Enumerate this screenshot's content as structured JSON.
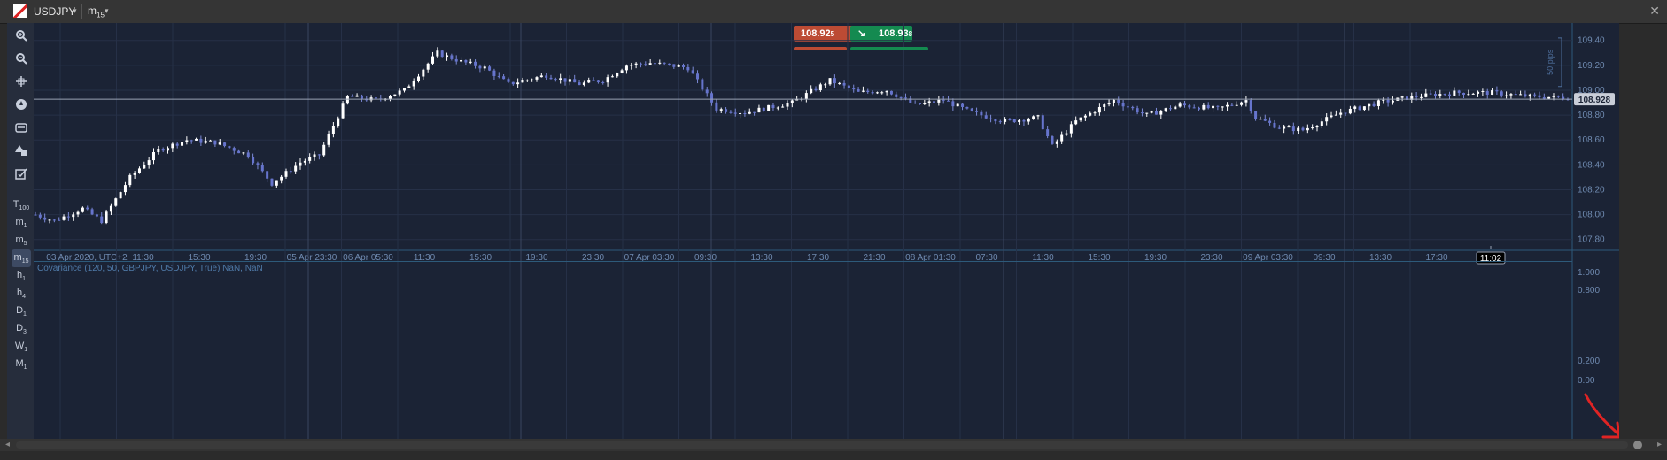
{
  "window": {
    "symbol": "USDJPY",
    "timeframe": "m",
    "timeframe_sub": "15"
  },
  "toolbar": {
    "tools": [
      "zoom-in-icon",
      "zoom-out-icon",
      "crosshair-icon",
      "compass-icon",
      "camera-icon",
      "shapes-icon",
      "checklist-icon"
    ],
    "timeframes": [
      {
        "label": "T",
        "sub": "100"
      },
      {
        "label": "m",
        "sub": "1"
      },
      {
        "label": "m",
        "sub": "5"
      },
      {
        "label": "m",
        "sub": "15"
      },
      {
        "label": "h",
        "sub": "1"
      },
      {
        "label": "h",
        "sub": "4"
      },
      {
        "label": "D",
        "sub": "1"
      },
      {
        "label": "D",
        "sub": "3"
      },
      {
        "label": "W",
        "sub": "1"
      },
      {
        "label": "M",
        "sub": "1"
      }
    ],
    "active_timeframe": 3
  },
  "quote": {
    "sell": "108.92",
    "sell_sup": "5",
    "buy": "108.93",
    "buy_sup": "8"
  },
  "chart_data": [
    {
      "type": "candlestick",
      "y_ticks": [
        "109.40",
        "109.20",
        "109.00",
        "108.80",
        "108.60",
        "108.40",
        "108.20",
        "108.00",
        "107.80"
      ],
      "ylim": [
        107.72,
        109.54
      ],
      "current_price": "108.928",
      "pips_label": "50 pips",
      "x_ticks": [
        "03 Apr 2020, UTC+2",
        "11:30",
        "15:30",
        "19:30",
        "05 Apr 23:30",
        "06 Apr 05:30",
        "11:30",
        "15:30",
        "19:30",
        "23:30",
        "07 Apr 03:30",
        "09:30",
        "13:30",
        "17:30",
        "21:30",
        "08 Apr 01:30",
        "07:30",
        "11:30",
        "15:30",
        "19:30",
        "23:30",
        "09 Apr 03:30",
        "09:30",
        "13:30",
        "17:30"
      ],
      "cursor_time": "11:02",
      "path": [
        [
          0,
          108.0
        ],
        [
          4,
          107.95
        ],
        [
          10,
          108.05
        ],
        [
          14,
          107.95
        ],
        [
          20,
          108.3
        ],
        [
          26,
          108.52
        ],
        [
          32,
          108.6
        ],
        [
          38,
          108.58
        ],
        [
          45,
          108.48
        ],
        [
          50,
          108.25
        ],
        [
          56,
          108.42
        ],
        [
          60,
          108.48
        ],
        [
          66,
          108.95
        ],
        [
          72,
          108.92
        ],
        [
          78,
          109.0
        ],
        [
          85,
          109.3
        ],
        [
          90,
          109.23
        ],
        [
          95,
          109.18
        ],
        [
          100,
          109.05
        ],
        [
          108,
          109.12
        ],
        [
          115,
          109.05
        ],
        [
          120,
          109.08
        ],
        [
          125,
          109.2
        ],
        [
          130,
          109.22
        ],
        [
          138,
          109.18
        ],
        [
          144,
          108.85
        ],
        [
          150,
          108.82
        ],
        [
          160,
          108.9
        ],
        [
          168,
          109.08
        ],
        [
          174,
          108.98
        ],
        [
          180,
          109.0
        ],
        [
          186,
          108.88
        ],
        [
          192,
          108.92
        ],
        [
          198,
          108.82
        ],
        [
          205,
          108.75
        ],
        [
          212,
          108.78
        ],
        [
          215,
          108.55
        ],
        [
          220,
          108.75
        ],
        [
          228,
          108.92
        ],
        [
          235,
          108.8
        ],
        [
          242,
          108.88
        ],
        [
          250,
          108.85
        ],
        [
          256,
          108.92
        ],
        [
          258,
          108.78
        ],
        [
          263,
          108.7
        ],
        [
          268,
          108.68
        ],
        [
          276,
          108.82
        ],
        [
          284,
          108.9
        ],
        [
          292,
          108.95
        ],
        [
          300,
          108.98
        ],
        [
          308,
          108.98
        ],
        [
          316,
          108.95
        ],
        [
          324,
          108.94
        ]
      ]
    },
    {
      "type": "line",
      "legend": "Covariance (120, 50, GBPJPY, USDJPY, True) NaN, NaN",
      "y_ticks": [
        "1.000",
        "0.800",
        "0.200",
        "0.00"
      ],
      "values": []
    }
  ]
}
